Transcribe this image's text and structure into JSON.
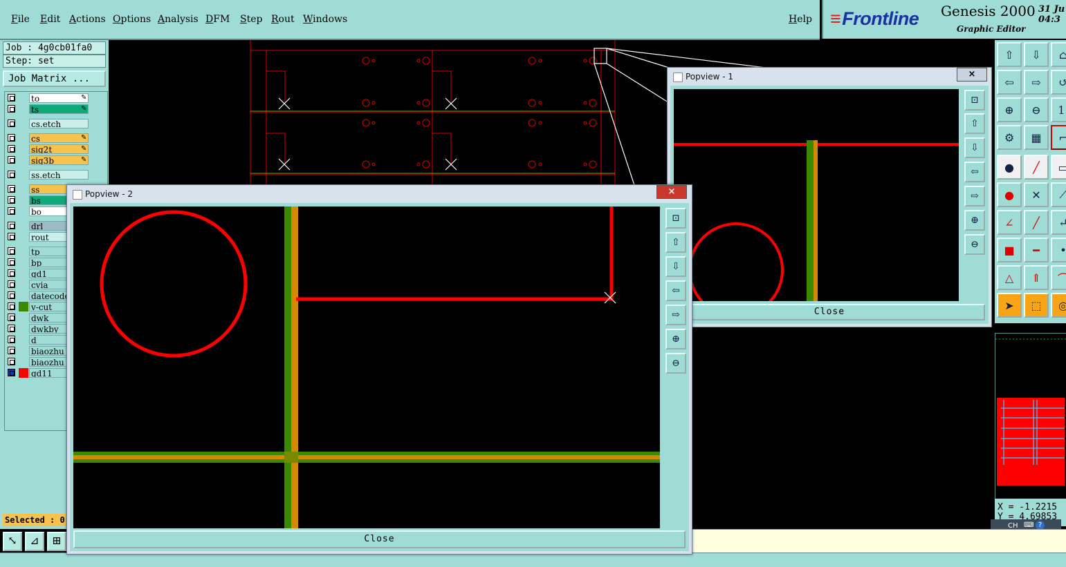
{
  "menu": {
    "items": [
      "File",
      "Edit",
      "Actions",
      "Options",
      "Analysis",
      "DFM",
      "Step",
      "Rout",
      "Windows"
    ],
    "help": "Help"
  },
  "brand": {
    "logo": "Frontline",
    "product": "Genesis 2000",
    "subtitle": "Graphic Editor",
    "date_line1": "31 Ju",
    "date_line2": "04:3"
  },
  "job": {
    "job_label": "Job : 4g0cb01fa0",
    "step_label": "Step: set",
    "matrix_button": "Job Matrix ..."
  },
  "layers": [
    {
      "name": "to",
      "color": "#ffffff",
      "mark": true
    },
    {
      "name": "ts",
      "color": "#0fa97a",
      "mark": true
    },
    {
      "name": "cs.etch",
      "color": "#c8efe9",
      "mark": false
    },
    {
      "name": "cs",
      "color": "#f7c34d",
      "mark": true
    },
    {
      "name": "sig2t",
      "color": "#f7c34d",
      "mark": true
    },
    {
      "name": "sig3b",
      "color": "#f7c34d",
      "mark": true
    },
    {
      "name": "ss.etch",
      "color": "#c8efe9",
      "mark": false
    },
    {
      "name": "ss",
      "color": "#f7c34d",
      "mark": false
    },
    {
      "name": "bs",
      "color": "#0fa97a",
      "mark": false
    },
    {
      "name": "bo",
      "color": "#ffffff",
      "mark": false
    },
    {
      "name": "drl",
      "color": "#9bbcc4",
      "mark": false
    },
    {
      "name": "rout",
      "color": "#c8efe9",
      "mark": false
    },
    {
      "name": "tp",
      "color": "#9fdcd5",
      "mark": false
    },
    {
      "name": "bp",
      "color": "#9fdcd5",
      "mark": false
    },
    {
      "name": "gd1",
      "color": "#9fdcd5",
      "mark": false
    },
    {
      "name": "cvia",
      "color": "#9fdcd5",
      "mark": false
    },
    {
      "name": "datecode",
      "color": "#9fdcd5",
      "mark": false
    },
    {
      "name": "v-cut",
      "color": "#9fdcd5",
      "mark": false
    },
    {
      "name": "dwk",
      "color": "#9fdcd5",
      "mark": false
    },
    {
      "name": "dwkby",
      "color": "#9fdcd5",
      "mark": false
    },
    {
      "name": "d",
      "color": "#9fdcd5",
      "mark": false
    },
    {
      "name": "biaozhu",
      "color": "#9fdcd5",
      "mark": false
    },
    {
      "name": "biaozhu",
      "color": "#9fdcd5",
      "mark": false
    },
    {
      "name": "gd11",
      "color": "#9fdcd5",
      "mark": false
    }
  ],
  "selected_label": "Selected : 0",
  "popview1": {
    "title": "Popview - 1",
    "close_label": "Close",
    "close_x": "×"
  },
  "popview2": {
    "title": "Popview - 2",
    "close_label": "Close",
    "close_x": "×"
  },
  "coords": {
    "x_label": "X = -1.2215",
    "y_label": "Y = 4.69853"
  },
  "ime": {
    "lang": "CH"
  },
  "colors": {
    "panel": "#9fdcd5",
    "feature_red": "#ff0000",
    "trace_green": "#3a8a00",
    "trace_orange": "#d38a00"
  }
}
